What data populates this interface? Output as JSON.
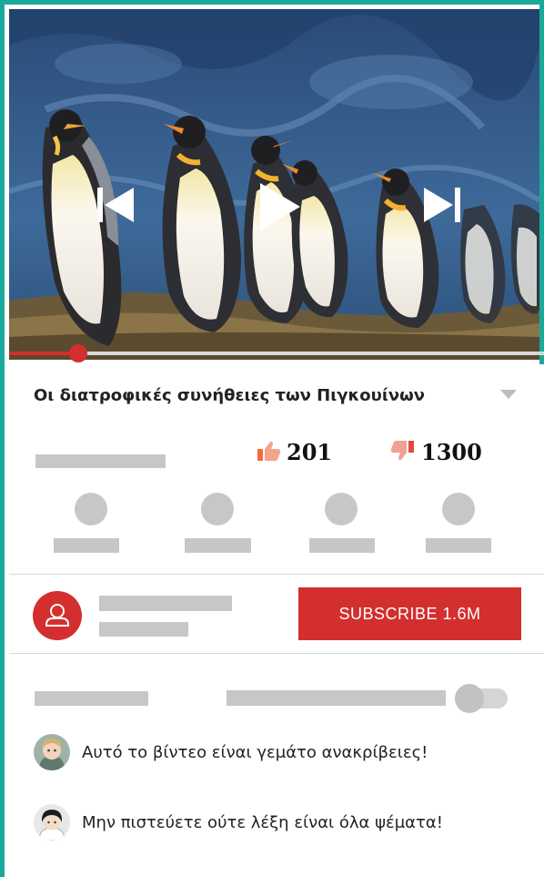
{
  "video": {
    "subject": "emperor penguins on rocky ground with blue ice background",
    "progress_percent": 13
  },
  "title": "Οι διατροφικές συνήθειες των Πιγκουίνων",
  "stats": {
    "likes": "201",
    "dislikes": "1300"
  },
  "channel": {
    "subscribe_label": "SUBSCRIBE 1.6M"
  },
  "comments": [
    {
      "text": "Αυτό το βίντεο είναι γεμάτο ανακρίβειες!"
    },
    {
      "text": "Μην πιστεύετε ούτε λέξη είναι όλα ψέματα!"
    }
  ],
  "colors": {
    "accent": "#d32f2f",
    "frame": "#19a99a",
    "placeholder": "#c7c7c7"
  },
  "icons": {
    "previous": "skip-previous-icon",
    "play": "play-icon",
    "next": "skip-next-icon",
    "like": "thumbs-up-icon",
    "dislike": "thumbs-down-icon",
    "expand": "chevron-down-icon",
    "user": "user-icon"
  }
}
